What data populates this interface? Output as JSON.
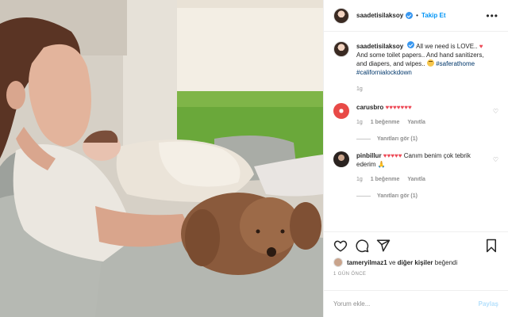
{
  "post": {
    "username": "saadetisilaksoy",
    "follow_label": "Takip Et",
    "more_label": "•••",
    "caption": {
      "username": "saadetisilaksoy",
      "text_1": "All we need is LOVE..",
      "text_2": "And some toilet papers.. And hand sanitizers, and diapers, and wipes..",
      "hashtag_1": "#saferathome",
      "hashtag_2": "#californialockdown",
      "time": "1g"
    },
    "comments": [
      {
        "username": "carusbro",
        "hearts": "♥♥♥♥♥♥♥",
        "text": "",
        "time": "1g",
        "likes": "1 beğenme",
        "reply": "Yanıtla",
        "replies": "Yanıtları gör (1)"
      },
      {
        "username": "pinbillur",
        "hearts": "♥♥♥♥♥",
        "text": "Canım benim çok tebrik ederim",
        "emoji": "🙏",
        "time": "1g",
        "likes": "1 beğenme",
        "reply": "Yanıtla",
        "replies": "Yanıtları gör (1)"
      }
    ],
    "liked_by": {
      "user": "tameryilmaz1",
      "middle": "ve",
      "others": "diğer kişiler",
      "end": "beğendi"
    },
    "ago": "1 GÜN ÖNCE",
    "add_comment_placeholder": "Yorum ekle...",
    "post_button": "Paylaş"
  },
  "icons": {
    "verified": "verified-badge",
    "like": "heart-icon",
    "comment": "comment-icon",
    "share": "share-icon",
    "save": "bookmark-icon"
  },
  "colors": {
    "link": "#0095f6",
    "heart": "#ed4956",
    "verified": "#3897f0",
    "hashtag": "#00376b"
  }
}
